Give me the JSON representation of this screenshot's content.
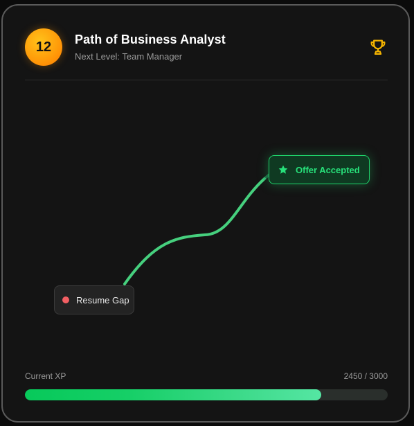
{
  "header": {
    "level": "12",
    "title": "Path of Business Analyst",
    "subtitle": "Next Level: Team Manager",
    "trophy_icon": "trophy-icon"
  },
  "path": {
    "nodes": [
      {
        "label": "Resume Gap",
        "icon": "dot-icon",
        "status_color": "#f25f63"
      },
      {
        "label": "Offer Accepted",
        "icon": "star-icon",
        "status_color": "#27e07a"
      }
    ]
  },
  "xp": {
    "label": "Current XP",
    "current": 2450,
    "max": 3000,
    "display": "2450 / 3000",
    "fill_fraction": 0.8167
  },
  "colors": {
    "accent": "#27e07a",
    "badge": "#ff9d0a",
    "danger": "#f25f63",
    "trophy": "#f5b400"
  }
}
